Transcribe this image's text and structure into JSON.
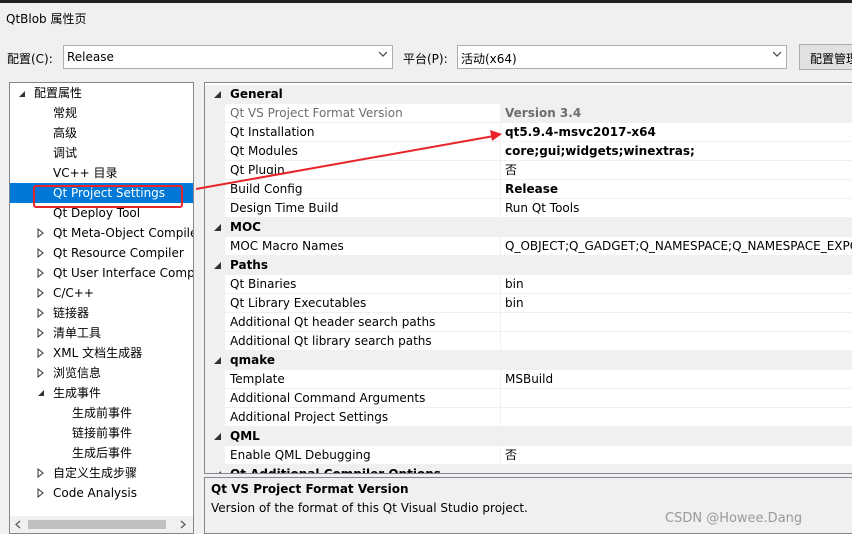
{
  "window": {
    "title": "QtBlob 属性页"
  },
  "toolbar": {
    "config_label": "配置(C):",
    "config_value": "Release",
    "platform_label": "平台(P):",
    "platform_value": "活动(x64)",
    "manager_button": "配置管理"
  },
  "tree": {
    "root": "配置属性",
    "items": [
      "常规",
      "高级",
      "调试",
      "VC++ 目录",
      "Qt Project Settings",
      "Qt Deploy Tool",
      "Qt Meta-Object Compile",
      "Qt Resource Compiler",
      "Qt User Interface Comp",
      "C/C++",
      "链接器",
      "清单工具",
      "XML 文档生成器",
      "浏览信息",
      "生成事件"
    ],
    "build_events": [
      "生成前事件",
      "链接前事件",
      "生成后事件"
    ],
    "tail": [
      "自定义生成步骤",
      "Code Analysis"
    ]
  },
  "grid": {
    "categories": [
      "General",
      "MOC",
      "Paths",
      "qmake",
      "QML",
      "Qt Additional Compiler Options"
    ],
    "general": [
      {
        "name": "Qt VS Project Format Version",
        "value": "Version 3.4"
      },
      {
        "name": "Qt Installation",
        "value": "qt5.9.4-msvc2017-x64"
      },
      {
        "name": "Qt Modules",
        "value": "core;gui;widgets;winextras;"
      },
      {
        "name": "Qt Plugin",
        "value": "否"
      },
      {
        "name": "Build Config",
        "value": "Release"
      },
      {
        "name": "Design Time Build",
        "value": "Run Qt Tools"
      }
    ],
    "moc": [
      {
        "name": "MOC Macro Names",
        "value": "Q_OBJECT;Q_GADGET;Q_NAMESPACE;Q_NAMESPACE_EXPO"
      }
    ],
    "paths": [
      {
        "name": "Qt Binaries",
        "value": "bin"
      },
      {
        "name": "Qt Library Executables",
        "value": "bin"
      },
      {
        "name": "Additional Qt header search paths",
        "value": ""
      },
      {
        "name": "Additional Qt library search paths",
        "value": ""
      }
    ],
    "qmake": [
      {
        "name": "Template",
        "value": "MSBuild"
      },
      {
        "name": "Additional Command Arguments",
        "value": ""
      },
      {
        "name": "Additional Project Settings",
        "value": ""
      }
    ],
    "qml": [
      {
        "name": "Enable QML Debugging",
        "value": "否"
      }
    ]
  },
  "description": {
    "title": "Qt VS Project Format Version",
    "text": "Version of the format of this Qt Visual Studio project."
  },
  "watermark": "CSDN @Howee.Dang",
  "colors": {
    "selection": "#0078d7",
    "annotation": "#e8242a"
  }
}
